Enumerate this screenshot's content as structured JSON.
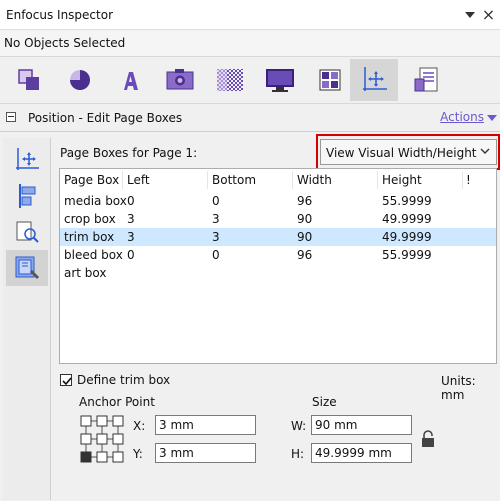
{
  "window": {
    "title": "Enfocus Inspector",
    "close_glyph": "×"
  },
  "status": {
    "text": "No Objects Selected"
  },
  "toolbar": {
    "tools": [
      {
        "name": "object-properties",
        "icon": "square-overlap-icon"
      },
      {
        "name": "fill-stroke",
        "icon": "pie-icon"
      },
      {
        "name": "text",
        "icon": "letter-a-icon"
      },
      {
        "name": "image",
        "icon": "camera-icon"
      },
      {
        "name": "transparency",
        "icon": "checker-icon"
      },
      {
        "name": "output",
        "icon": "monitor-icon"
      },
      {
        "name": "color-separations",
        "icon": "grid-icon"
      },
      {
        "name": "position",
        "icon": "move-arrows-icon",
        "active": true
      },
      {
        "name": "document",
        "icon": "document-list-icon"
      }
    ]
  },
  "section": {
    "title": "Position - Edit Page Boxes",
    "actions_label": "Actions"
  },
  "sidebar": {
    "tools": [
      {
        "icon": "move-axes-icon"
      },
      {
        "icon": "align-icon"
      },
      {
        "icon": "zoom-page-icon"
      },
      {
        "icon": "page-box-edit-icon",
        "active": true
      }
    ]
  },
  "page_boxes": {
    "label": "Page Boxes for Page 1:",
    "view_select": "View Visual Width/Height",
    "columns": [
      "Page Box",
      "Left",
      "Bottom",
      "Width",
      "Height",
      "!"
    ],
    "rows": [
      {
        "name": "media box",
        "left": "0",
        "bottom": "0",
        "width": "96",
        "height": "55.9999"
      },
      {
        "name": "crop box",
        "left": "3",
        "bottom": "3",
        "width": "90",
        "height": "49.9999"
      },
      {
        "name": "trim box",
        "left": "3",
        "bottom": "3",
        "width": "90",
        "height": "49.9999",
        "selected": true
      },
      {
        "name": "bleed box",
        "left": "0",
        "bottom": "0",
        "width": "96",
        "height": "55.9999"
      },
      {
        "name": "art box",
        "left": "",
        "bottom": "",
        "width": "",
        "height": ""
      }
    ]
  },
  "define": {
    "label": "Define trim box",
    "checked": true,
    "units": "Units: mm"
  },
  "anchor": {
    "label": "Anchor Point",
    "x_label": "X:",
    "x_value": "3 mm",
    "y_label": "Y:",
    "y_value": "3 mm",
    "selected": "bottom-left"
  },
  "size": {
    "label": "Size",
    "w_label": "W:",
    "w_value": "90 mm",
    "h_label": "H:",
    "h_value": "49.9999 mm"
  },
  "colors": {
    "accent": "#6a5acd",
    "highlight": "#d40000",
    "selection": "#cde8ff"
  }
}
